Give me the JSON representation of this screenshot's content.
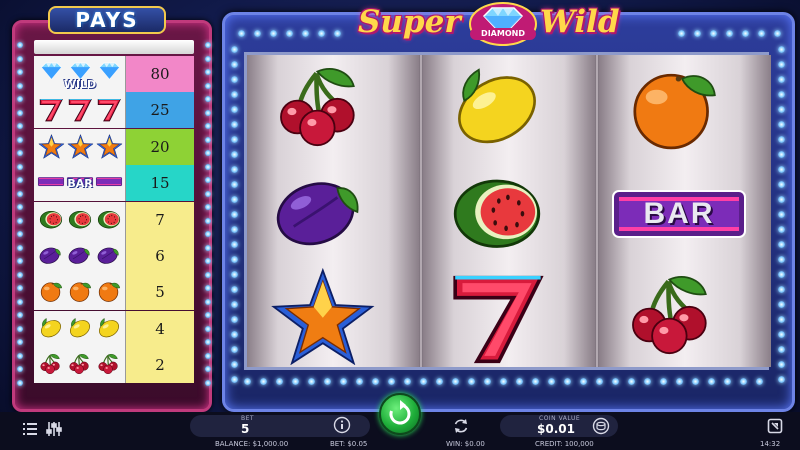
{
  "game": {
    "logo_word_1": "Super",
    "logo_word_2": "Wild",
    "logo_badge": "DIAMOND"
  },
  "pays": {
    "title": "PAYS",
    "rows": [
      {
        "symbol": "diamond-wild",
        "label": "WILD",
        "payout": "80",
        "color": "#f287c8"
      },
      {
        "symbol": "seven",
        "label": "",
        "payout": "25",
        "color": "#3fa3e6"
      },
      {
        "symbol": "star",
        "label": "",
        "payout": "20",
        "color": "#8ed235"
      },
      {
        "symbol": "bar",
        "label": "BAR",
        "payout": "15",
        "color": "#26d6c8"
      },
      {
        "symbol": "watermelon",
        "label": "",
        "payout": "7",
        "color": "#f7ec8c"
      },
      {
        "symbol": "plum",
        "label": "",
        "payout": "6",
        "color": "#f7ec8c"
      },
      {
        "symbol": "orange",
        "label": "",
        "payout": "5",
        "color": "#f7ec8c"
      },
      {
        "symbol": "lemon",
        "label": "",
        "payout": "4",
        "color": "#f7ec8c"
      },
      {
        "symbol": "cherry",
        "label": "",
        "payout": "2",
        "color": "#f7ec8c"
      }
    ]
  },
  "reels": [
    [
      "cherry",
      "plum",
      "star"
    ],
    [
      "lemon",
      "watermelon",
      "seven"
    ],
    [
      "orange",
      "bar",
      "cherry"
    ]
  ],
  "reel_bar_label": "BAR",
  "controls": {
    "bet_label": "BET",
    "bet_value": "5",
    "coin_value_label": "COIN VALUE",
    "coin_value": "$0.01",
    "balance_text": "BALANCE: $1,000.00",
    "bet_amount_text": "BET: $0.05",
    "win_text": "WIN: $0.00",
    "credit_text": "CREDIT: 100,000",
    "clock": "14:32"
  },
  "icons": {
    "menu": "list-icon",
    "settings": "sliders-icon",
    "info": "info-icon",
    "spin": "spin-arrow-icon",
    "autoplay": "refresh-icon",
    "coins": "coin-stack-icon",
    "exit": "exit-icon"
  }
}
